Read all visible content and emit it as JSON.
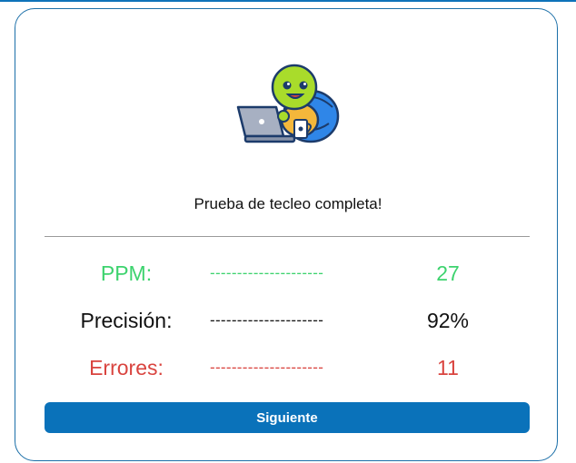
{
  "result": {
    "message": "Prueba de tecleo completa!",
    "mascot_icon": "turtle-with-laptop-icon"
  },
  "stats": [
    {
      "label": "PPM:",
      "dashes": "---------------------",
      "value": "27",
      "color": "#3dd36e"
    },
    {
      "label": "Precisión:",
      "dashes": "---------------------",
      "value": "92%",
      "color": "#111111"
    },
    {
      "label": "Errores:",
      "dashes": "---------------------",
      "value": "11",
      "color": "#d9443f"
    }
  ],
  "actions": {
    "next_label": "Siguiente"
  },
  "colors": {
    "accent": "#0a72ba",
    "border": "#1b6fa8",
    "success": "#3dd36e",
    "error": "#d9443f"
  }
}
